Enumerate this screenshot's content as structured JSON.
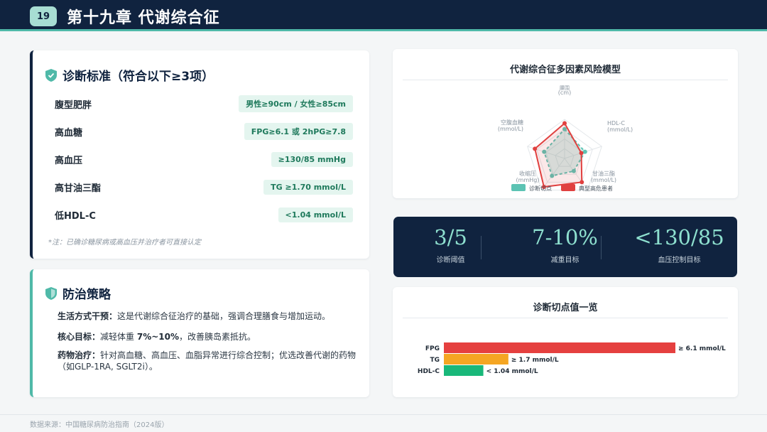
{
  "header": {
    "chapter_number": "19",
    "title": "第十九章 代谢综合征"
  },
  "diagnosis": {
    "title": "诊断标准（符合以下≥3项）",
    "items": [
      {
        "name": "腹型肥胖",
        "value": "男性≥90cm / 女性≥85cm"
      },
      {
        "name": "高血糖",
        "value": "FPG≥6.1 或 2hPG≥7.8"
      },
      {
        "name": "高血压",
        "value": "≥130/85 mmHg"
      },
      {
        "name": "高甘油三酯",
        "value": "TG ≥1.70 mmol/L"
      },
      {
        "name": "低HDL-C",
        "value": "<1.04 mmol/L"
      }
    ],
    "note": "*注：已确诊糖尿病或高血压并治疗者可直接认定"
  },
  "prevention": {
    "title": "防治策略",
    "items": [
      {
        "label": "生活方式干预：",
        "text": "这是代谢综合征治疗的基础，强调合理膳食与增加运动。"
      },
      {
        "label": "核心目标：",
        "text_before": "减轻体重 ",
        "highlight": "7%~10%",
        "text_after": "，改善胰岛素抵抗。"
      },
      {
        "label": "药物治疗：",
        "text": "针对高血糖、高血压、血脂异常进行综合控制；优选改善代谢的药物（如GLP-1RA, SGLT2i）。"
      }
    ]
  },
  "radar": {
    "title": "代谢综合征多因素风险模型",
    "axes": [
      {
        "label": "腰围",
        "unit": "(cm)"
      },
      {
        "label": "HDL-C",
        "unit": "(mmol/L)"
      },
      {
        "label": "甘油三酯",
        "unit": "(mmol/L)"
      },
      {
        "label": "收缩压",
        "unit": "(mmHg)"
      },
      {
        "label": "空腹血糖",
        "unit": "(mmol/L)"
      }
    ],
    "legend": [
      {
        "name": "诊断切点",
        "color": "#5cc3b3"
      },
      {
        "name": "典型高危患者",
        "color": "#e0403f"
      }
    ]
  },
  "stats": [
    {
      "value": "3/5",
      "label": "诊断阈值"
    },
    {
      "value": "7-10%",
      "label": "减重目标"
    },
    {
      "value": "<130/85",
      "label": "血压控制目标"
    }
  ],
  "bars": {
    "title": "诊断切点值一览"
  },
  "chart_data": [
    {
      "type": "radar",
      "title": "代谢综合征多因素风险模型",
      "axes": [
        "腰围 (cm)",
        "HDL-C (mmol/L)",
        "甘油三酯 (mmol/L)",
        "收缩压 (mmHg)",
        "空腹血糖 (mmol/L)"
      ],
      "max": 1,
      "series": [
        {
          "name": "诊断切点",
          "values": [
            0.75,
            0.55,
            0.4,
            0.55,
            0.55
          ],
          "color": "#5cc3b3"
        },
        {
          "name": "典型高危患者",
          "values": [
            0.9,
            0.45,
            0.75,
            0.9,
            0.8
          ],
          "color": "#e0403f"
        }
      ]
    },
    {
      "type": "bar",
      "orientation": "horizontal",
      "title": "诊断切点值一览",
      "categories": [
        "FPG",
        "TG",
        "HDL-C"
      ],
      "values": [
        6.1,
        1.7,
        1.04
      ],
      "labels": [
        "≥ 6.1 mmol/L",
        "≥ 1.7 mmol/L",
        "< 1.04 mmol/L"
      ],
      "colors": [
        "#e5403f",
        "#f5a623",
        "#19b87a"
      ],
      "xlim": [
        0,
        6.1
      ]
    }
  ],
  "footer": {
    "source": "数据来源：中国糖尿病防治指南（2024版）"
  }
}
